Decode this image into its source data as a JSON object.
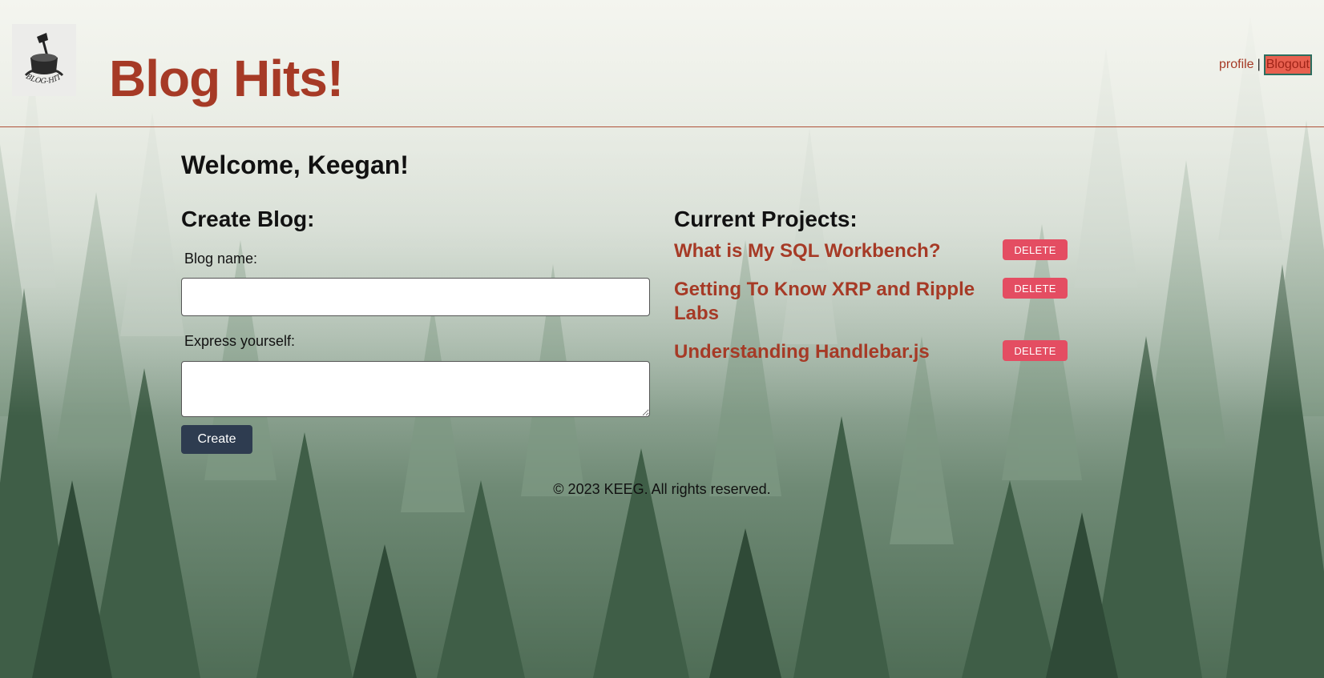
{
  "header": {
    "logo_text": "BLOG-HITS",
    "title": "Blog Hits!",
    "nav": {
      "profile_label": "profile",
      "separator": "|",
      "logout_label": "Blogout"
    }
  },
  "main": {
    "welcome": "Welcome, Keegan!",
    "create": {
      "heading": "Create Blog:",
      "name_label": "Blog name:",
      "name_value": "",
      "body_label": "Express yourself:",
      "body_value": "",
      "submit_label": "Create"
    },
    "projects": {
      "heading": "Current Projects:",
      "items": [
        {
          "title": "What is My SQL Workbench?",
          "delete_label": "DELETE"
        },
        {
          "title": "Getting To Know XRP and Ripple Labs",
          "delete_label": "DELETE"
        },
        {
          "title": "Understanding Handlebar.js",
          "delete_label": "DELETE"
        }
      ]
    }
  },
  "footer": {
    "text": "© 2023 KEEG. All rights reserved."
  },
  "colors": {
    "brand": "#a63a26",
    "create_button": "#2e3c50",
    "delete_button": "#e44d62",
    "logout_bg": "#e8604f",
    "logout_border": "#2c6e5f"
  },
  "icons": {
    "logo": "axe-in-stump-icon"
  }
}
